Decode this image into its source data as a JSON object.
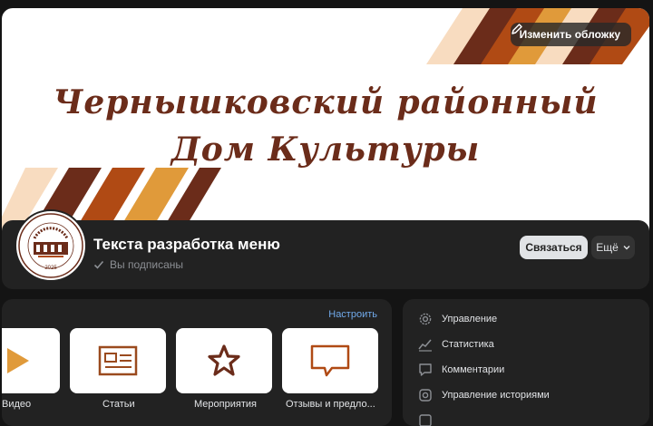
{
  "cover": {
    "title_line1": "Чернышковский районный",
    "title_line2": "Дом Культуры",
    "edit_button_label": "Изменить обложку",
    "colors": [
      "#6b2c1a",
      "#b04a14",
      "#e09a3a",
      "#f8dcc0"
    ]
  },
  "header": {
    "group_name": "Текста разработка меню",
    "subscribed_label": "Вы подписаны",
    "contact_button": "Связаться",
    "more_button": "Ещё",
    "avatar_logo_year": "2025"
  },
  "menu": {
    "configure_label": "Настроить",
    "items": [
      {
        "label": "Видео",
        "icon": "play-icon"
      },
      {
        "label": "Статьи",
        "icon": "article-icon"
      },
      {
        "label": "Мероприятия",
        "icon": "star-icon"
      },
      {
        "label": "Отзывы и предло...",
        "icon": "feedback-icon"
      }
    ]
  },
  "side": {
    "items": [
      {
        "label": "Управление",
        "icon": "gear-icon"
      },
      {
        "label": "Статистика",
        "icon": "chart-icon"
      },
      {
        "label": "Комментарии",
        "icon": "comment-icon"
      },
      {
        "label": "Управление историями",
        "icon": "stories-icon"
      }
    ]
  }
}
